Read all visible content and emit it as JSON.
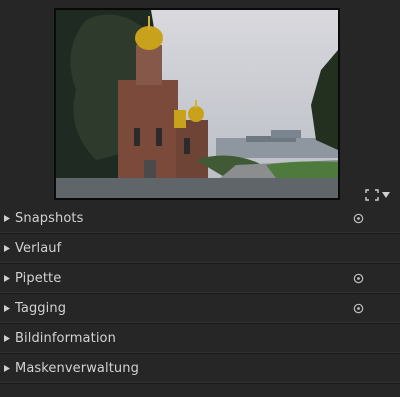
{
  "navigation": {
    "preview_alt": "church-thumbnail",
    "zoom_icon": "fit-screen-icon",
    "zoom_dropdown_icon": "chevron-down-icon"
  },
  "modules": [
    {
      "label": "Snapshots",
      "has_preset": true
    },
    {
      "label": "Verlauf",
      "has_preset": false
    },
    {
      "label": "Pipette",
      "has_preset": true
    },
    {
      "label": "Tagging",
      "has_preset": true
    },
    {
      "label": "Bildinformation",
      "has_preset": false
    },
    {
      "label": "Maskenverwaltung",
      "has_preset": false
    }
  ],
  "colors": {
    "panel_bg": "#262626",
    "text": "#d2d2d2",
    "icon": "#bdbdbd"
  }
}
